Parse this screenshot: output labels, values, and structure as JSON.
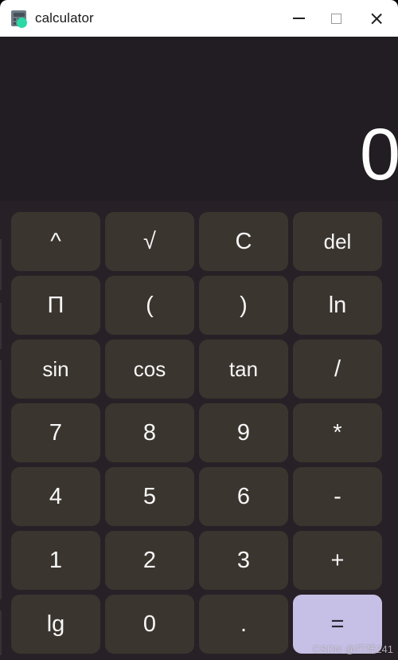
{
  "window": {
    "title": "calculator",
    "icon": "calculator-icon",
    "controls": {
      "minimize": "minimize-icon",
      "maximize": "maximize-icon",
      "close": "close-icon"
    }
  },
  "display": {
    "value": "0"
  },
  "keypad": {
    "rows": [
      [
        {
          "label": "^",
          "role": "operator"
        },
        {
          "label": "√",
          "role": "function"
        },
        {
          "label": "C",
          "role": "clear"
        },
        {
          "label": "del",
          "role": "delete"
        }
      ],
      [
        {
          "label": "Π",
          "role": "constant"
        },
        {
          "label": "(",
          "role": "paren-open"
        },
        {
          "label": ")",
          "role": "paren-close"
        },
        {
          "label": "ln",
          "role": "function"
        }
      ],
      [
        {
          "label": "sin",
          "role": "function"
        },
        {
          "label": "cos",
          "role": "function"
        },
        {
          "label": "tan",
          "role": "function"
        },
        {
          "label": "/",
          "role": "operator"
        }
      ],
      [
        {
          "label": "7",
          "role": "digit"
        },
        {
          "label": "8",
          "role": "digit"
        },
        {
          "label": "9",
          "role": "digit"
        },
        {
          "label": "*",
          "role": "operator"
        }
      ],
      [
        {
          "label": "4",
          "role": "digit"
        },
        {
          "label": "5",
          "role": "digit"
        },
        {
          "label": "6",
          "role": "digit"
        },
        {
          "label": "-",
          "role": "operator"
        }
      ],
      [
        {
          "label": "1",
          "role": "digit"
        },
        {
          "label": "2",
          "role": "digit"
        },
        {
          "label": "3",
          "role": "digit"
        },
        {
          "label": "+",
          "role": "operator"
        }
      ],
      [
        {
          "label": "lg",
          "role": "function"
        },
        {
          "label": "0",
          "role": "digit"
        },
        {
          "label": ".",
          "role": "decimal"
        },
        {
          "label": "=",
          "role": "equals",
          "accent": true
        }
      ]
    ]
  },
  "watermark": {
    "text": "CSDN @打烊241"
  },
  "colors": {
    "window_background": "#272127",
    "display_background": "#221d22",
    "key_background": "#3b352f",
    "key_text": "#f7f7f7",
    "accent": "#c6bfe6",
    "titlebar_background": "#ffffff",
    "titlebar_text": "#1a1a1a"
  }
}
